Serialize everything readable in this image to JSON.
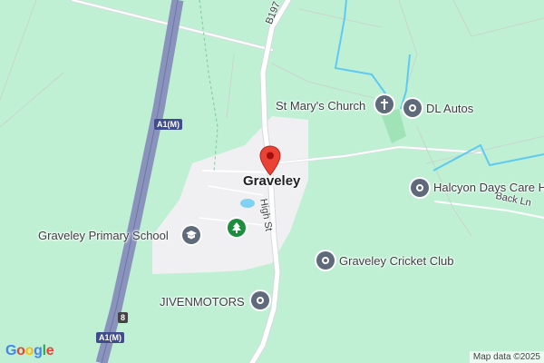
{
  "map": {
    "town": "Graveley",
    "colors": {
      "land": "#bff0d4",
      "settlement": "#f0f0f2",
      "motorway": "#8a93bc",
      "road": "#ffffff",
      "water": "#5ecaf2",
      "poi_grey": "#5f6b7a",
      "poi_green": "#1e8e3e",
      "pin": "#ea4335"
    },
    "roads": {
      "b197": "B197",
      "high_st": "High St",
      "back_ln": "Back Ln",
      "a1m_top": "A1(M)",
      "a1m_bottom": "A1(M)",
      "shield_small": "8"
    },
    "pois": [
      {
        "name": "St Mary's Church",
        "icon": "cross-icon"
      },
      {
        "name": "DL Autos",
        "icon": "pin-icon"
      },
      {
        "name": "Halcyon Days Care H",
        "icon": "pin-icon"
      },
      {
        "name": "Graveley Primary School",
        "icon": "school-icon"
      },
      {
        "name": "Graveley Cricket Club",
        "icon": "pin-icon"
      },
      {
        "name": "JIVENMOTORS",
        "icon": "pin-icon"
      },
      {
        "name": "",
        "icon": "tree-icon"
      }
    ],
    "attribution": "Map data ©2025",
    "logo": "Google"
  }
}
